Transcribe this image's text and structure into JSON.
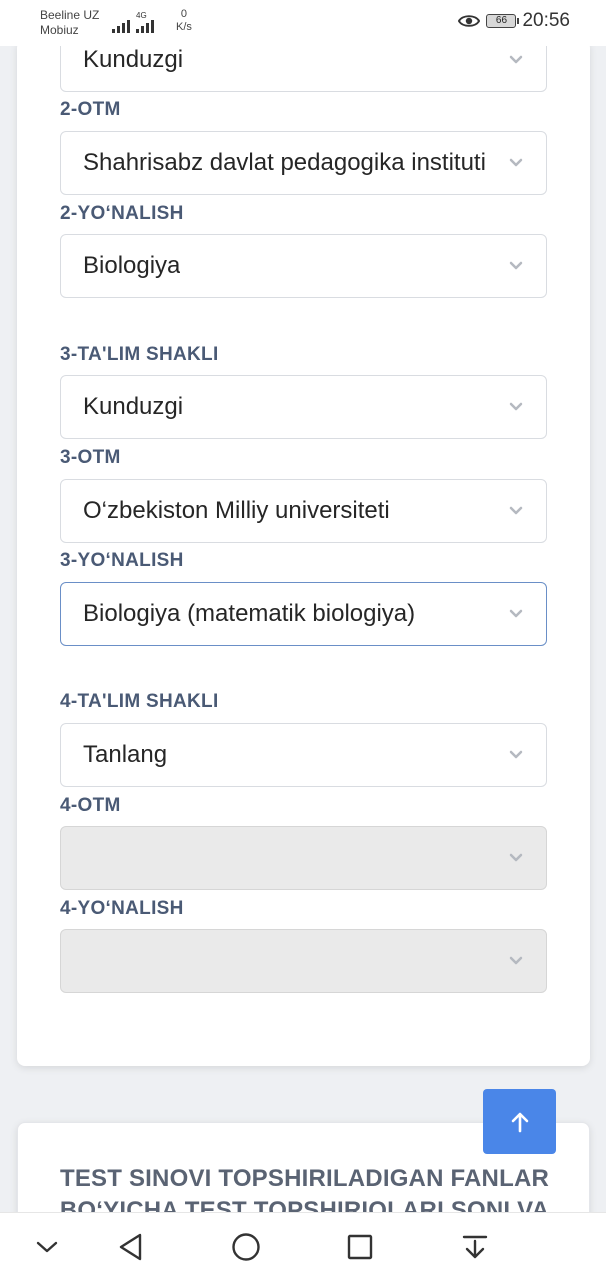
{
  "status_bar": {
    "carrier_line1": "Beeline UZ",
    "carrier_line2": "Mobiuz",
    "network_type": "4G",
    "speed_value": "0",
    "speed_unit": "K/s",
    "battery": "66",
    "time": "20:56"
  },
  "form": {
    "fields": [
      {
        "label": "",
        "value": "Kunduzgi",
        "state": "normal"
      },
      {
        "label": "2-OTM",
        "value": "Shahrisabz davlat pedagogika instituti",
        "state": "normal"
      },
      {
        "label": "2-YO‘NALISH",
        "value": "Biologiya",
        "state": "normal"
      },
      {
        "label": "3-TA'LIM SHAKLI",
        "value": "Kunduzgi",
        "state": "normal"
      },
      {
        "label": "3-OTM",
        "value": "O‘zbekiston Milliy universiteti",
        "state": "normal"
      },
      {
        "label": "3-YO‘NALISH",
        "value": "Biologiya (matematik biologiya)",
        "state": "focused"
      },
      {
        "label": "4-TA'LIM SHAKLI",
        "value": "Tanlang",
        "state": "normal"
      },
      {
        "label": "4-OTM",
        "value": "",
        "state": "disabled"
      },
      {
        "label": "4-YO‘NALISH",
        "value": "",
        "state": "disabled"
      }
    ]
  },
  "section2": {
    "title_line1": "TEST SINOVI TOPSHIRILADIGAN FANLAR",
    "title_line2": "BO‘YICHA TEST TOPSHIRIQLARI SONI VA"
  },
  "colors": {
    "accent": "#4a86e8",
    "label": "#4a5a75",
    "focus_border": "#6a8fc7"
  },
  "icons": [
    "chevron-down-icon",
    "arrow-up-icon",
    "eye-icon",
    "back-icon",
    "home-icon",
    "recents-icon",
    "notification-pull-icon"
  ]
}
